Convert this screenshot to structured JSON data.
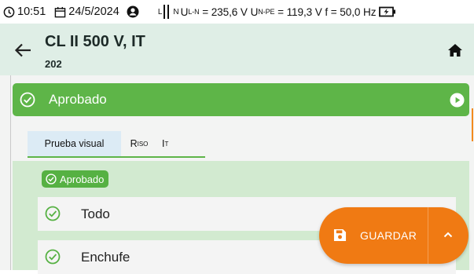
{
  "status_bar": {
    "time": "10:51",
    "date": "24/5/2024",
    "network_label": "L",
    "network_sub": "N",
    "u_ln_prefix": "U",
    "u_ln_sub": "L-N",
    "u_ln_value": " = 235,6 V ",
    "u_npe_prefix": "U",
    "u_npe_sub": "N-PE",
    "u_npe_value": " = 119,3 V ",
    "frequency": "f = 50,0 Hz"
  },
  "header": {
    "title": "CL II 500 V, IT",
    "subtitle": "202"
  },
  "banner": {
    "status": "Aprobado",
    "color": "#5eb548"
  },
  "tabs": [
    {
      "label": "Prueba visual"
    },
    {
      "label": "R",
      "sub": "ISO"
    },
    {
      "label": "I",
      "sub": "T"
    }
  ],
  "panel": {
    "chip": "Aprobado",
    "items": [
      {
        "label": "Todo"
      },
      {
        "label": "Enchufe"
      }
    ]
  },
  "fab": {
    "save_label": "GUARDAR",
    "color": "#f07a13"
  }
}
